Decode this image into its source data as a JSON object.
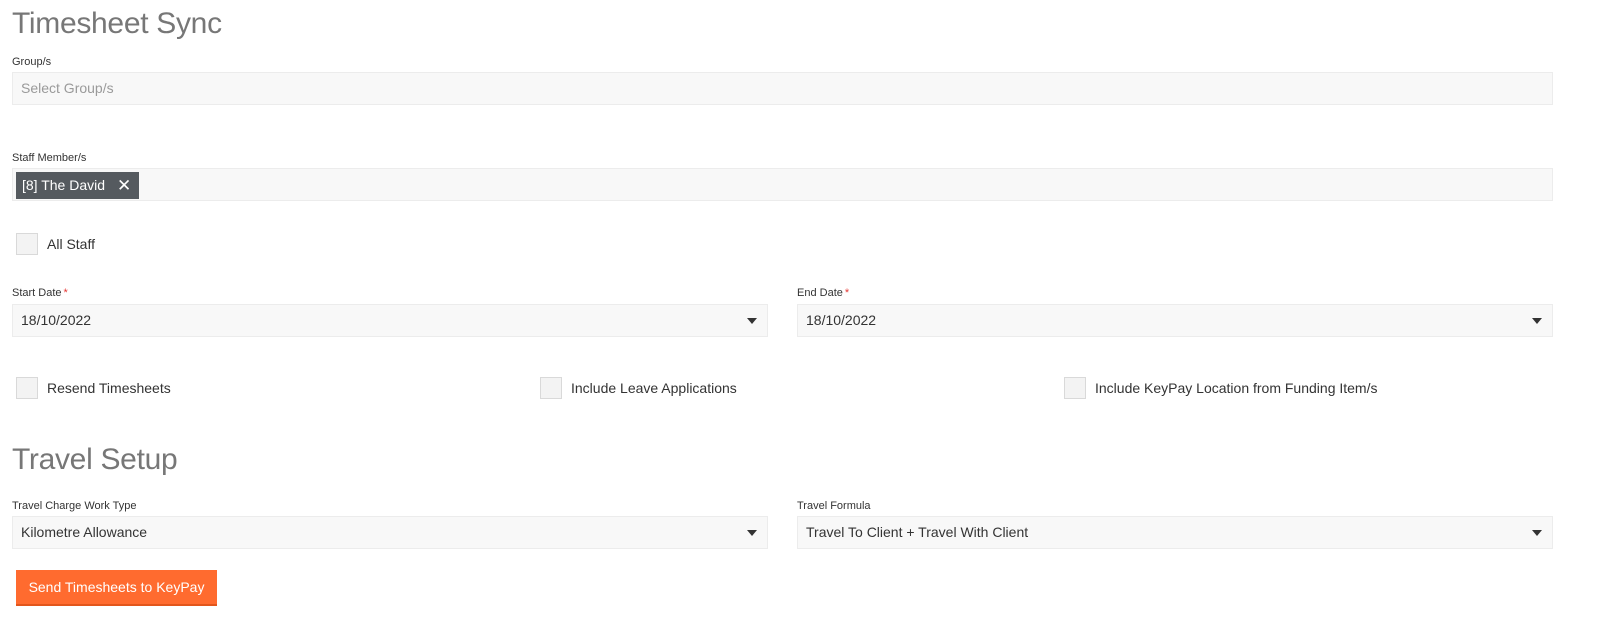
{
  "timesheet_sync": {
    "title": "Timesheet Sync",
    "groups": {
      "label": "Group/s",
      "placeholder": "Select Group/s"
    },
    "staff": {
      "label": "Staff Member/s",
      "selected_chip": "[8] The David"
    },
    "all_staff_label": "All Staff",
    "start_date": {
      "label": "Start Date",
      "required_mark": "*",
      "value": "18/10/2022"
    },
    "end_date": {
      "label": "End Date",
      "required_mark": "*",
      "value": "18/10/2022"
    },
    "options": {
      "resend_label": "Resend Timesheets",
      "include_leave_label": "Include Leave Applications",
      "include_keypay_location_label": "Include KeyPay Location from Funding Item/s"
    }
  },
  "travel_setup": {
    "title": "Travel Setup",
    "charge_work_type": {
      "label": "Travel Charge Work Type",
      "value": "Kilometre Allowance"
    },
    "formula": {
      "label": "Travel Formula",
      "value": "Travel To Client + Travel With Client"
    }
  },
  "actions": {
    "send_label": "Send Timesheets to KeyPay"
  },
  "colors": {
    "accent": "#ff6b2f",
    "chip_bg": "#555a5f",
    "required": "#e53935",
    "heading": "#777777"
  },
  "icons": {
    "chip_remove": "close-icon",
    "dropdown": "caret-down-icon"
  }
}
